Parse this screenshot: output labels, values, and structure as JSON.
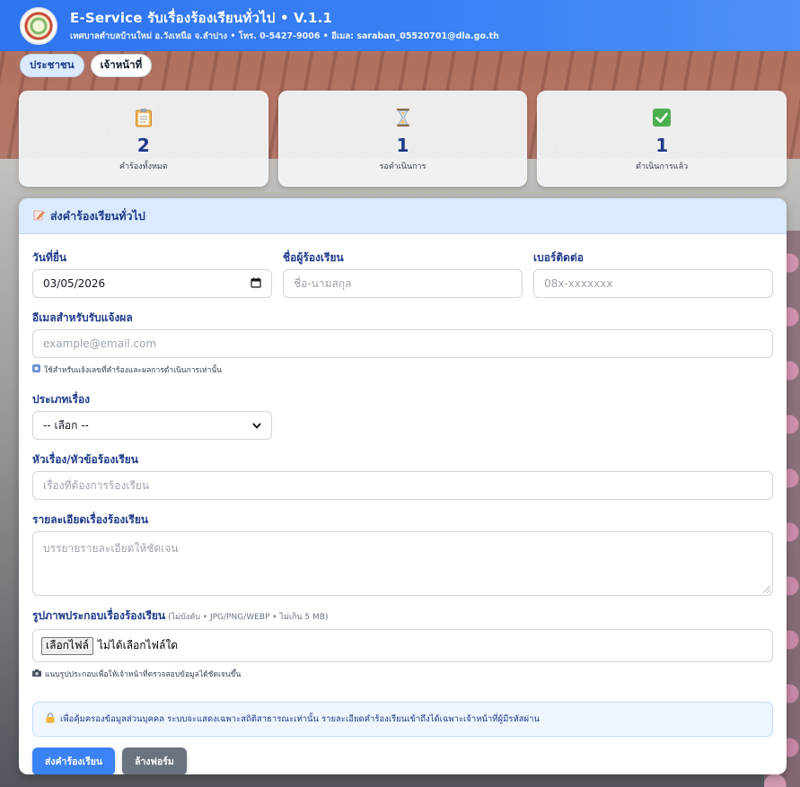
{
  "header": {
    "title": "E-Service รับเรื่องร้องเรียนทั่วไป • V.1.1",
    "subtitle": "เทศบาลตำบลบ้านใหม่ อ.วังเหนือ จ.ลำปาง • โทร. 0-5427-9006 • อีเมล: saraban_05520701@dla.go.th"
  },
  "tabs": [
    {
      "label": "ประชาชน",
      "active": true
    },
    {
      "label": "เจ้าหน้าที่",
      "active": false
    }
  ],
  "stats": [
    {
      "icon": "clipboard-icon",
      "value": "2",
      "label": "คำร้องทั้งหมด"
    },
    {
      "icon": "hourglass-icon",
      "value": "1",
      "label": "รอดำเนินการ"
    },
    {
      "icon": "check-box-icon",
      "value": "1",
      "label": "ดำเนินการแล้ว"
    }
  ],
  "form": {
    "title": "ส่งคำร้องเรียนทั่วไป",
    "date": {
      "label": "วันที่ยื่น",
      "value": "03/05/2026"
    },
    "name": {
      "label": "ชื่อผู้ร้องเรียน",
      "placeholder": "ชื่อ-นามสกุล"
    },
    "phone": {
      "label": "เบอร์ติดต่อ",
      "placeholder": "08x-xxxxxxx"
    },
    "email": {
      "label": "อีเมลสำหรับรับแจ้งผล",
      "placeholder": "example@email.com",
      "note": "ใช้สำหรับแจ้งเลขที่คำร้องและผลการดำเนินการเท่านั้น"
    },
    "category": {
      "label": "ประเภทเรื่อง",
      "selected": "-- เลือก --"
    },
    "subject": {
      "label": "หัวเรื่อง/หัวข้อร้องเรียน",
      "placeholder": "เรื่องที่ต้องการร้องเรียน"
    },
    "detail": {
      "label": "รายละเอียดเรื่องร้องเรียน",
      "placeholder": "บรรยายรายละเอียดให้ชัดเจน"
    },
    "image": {
      "label": "รูปภาพประกอบเรื่องร้องเรียน",
      "hint": "(ไม่บังคับ • JPG/PNG/WEBP • ไม่เกิน 5 MB)",
      "button_label": "เลือกไฟล์",
      "status": "ไม่ได้เลือกไฟล์ใด",
      "note": "แนบรูปประกอบเพื่อให้เจ้าหน้าที่ตรวจสอบข้อมูลได้ชัดเจนขึ้น"
    },
    "privacy_notice": "เพื่อคุ้มครองข้อมูลส่วนบุคคล ระบบจะแสดงเฉพาะสถิติสาธารณะเท่านั้น รายละเอียดคำร้องเรียนเข้าถึงได้เฉพาะเจ้าหน้าที่ผู้มีรหัสผ่าน",
    "submit_label": "ส่งคำร้องเรียน",
    "reset_label": "ล้างฟอร์ม"
  },
  "colors": {
    "header": "#3b82f6",
    "accent_text": "#1e3a8a",
    "card_head": "#dbeafe",
    "primary_button": "#3b82f6",
    "secondary_button": "#6b7280"
  }
}
